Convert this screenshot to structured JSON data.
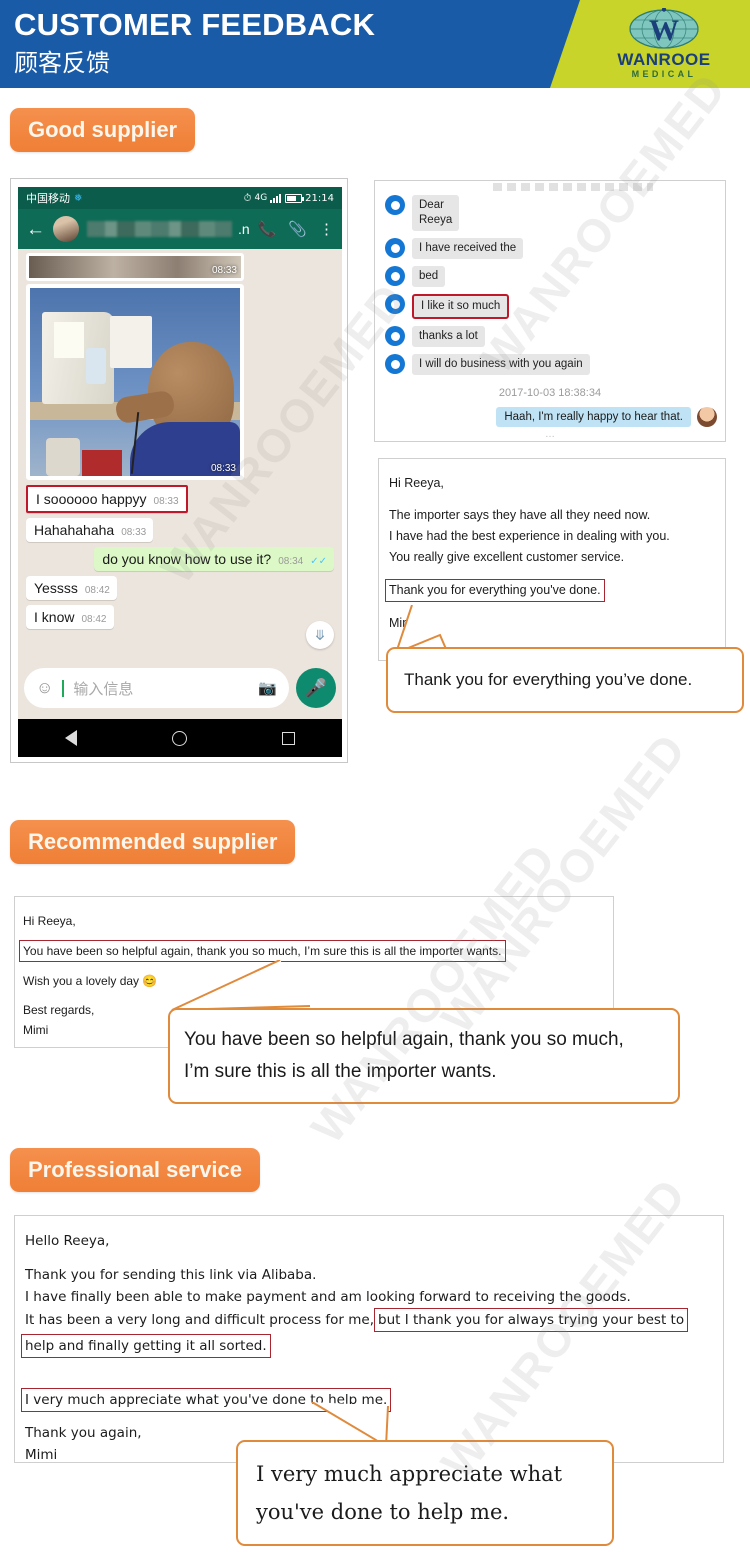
{
  "header": {
    "title_en": "CUSTOMER FEEDBACK",
    "title_cn": "顾客反馈",
    "logo_name": "WANROOE",
    "logo_sub": "MEDICAL",
    "logo_letter": "W",
    "brand_blue": "#1A5BA8",
    "brand_lime": "#C8D429",
    "brand_orange": "#EF7F35"
  },
  "watermark": {
    "text": "WANROOEMED"
  },
  "sections": [
    {
      "badge": "Good supplier"
    },
    {
      "badge": "Recommended supplier"
    },
    {
      "badge": "Professional service"
    }
  ],
  "phone": {
    "carrier": "中国移动",
    "network": "4G",
    "clock": "21:14",
    "contact_suffix": ".n",
    "icons": {
      "back": "back-arrow-icon",
      "call": "phone-icon",
      "attach": "paperclip-icon",
      "more": "more-vertical-icon",
      "alarm": "alarm-icon",
      "emoji": "emoji-icon",
      "camera": "camera-icon",
      "mic": "microphone-icon",
      "scroll": "chevron-double-down-icon"
    },
    "photo_time": "08:33",
    "strip_time": "08:33",
    "messages": [
      {
        "text": "I soooooo happyy",
        "time": "08:33",
        "out": false,
        "highlight": true
      },
      {
        "text": "Hahahahaha",
        "time": "08:33",
        "out": false,
        "highlight": false
      },
      {
        "text": "do you know how to use it?",
        "time": "08:34",
        "out": true,
        "highlight": false
      },
      {
        "text": "Yessss",
        "time": "08:42",
        "out": false,
        "highlight": false
      },
      {
        "text": "I know",
        "time": "08:42",
        "out": false,
        "highlight": false
      }
    ],
    "input_placeholder": "输入信息"
  },
  "webchat": {
    "incoming": [
      {
        "text": "Dear\nReeya",
        "highlight": false
      },
      {
        "text": "I have received the",
        "highlight": false
      },
      {
        "text": "bed",
        "highlight": false
      },
      {
        "text": "I like it so much",
        "highlight": true
      },
      {
        "text": "thanks a lot",
        "highlight": false
      },
      {
        "text": "I will do business with you again",
        "highlight": false
      }
    ],
    "timestamp": "2017-10-03 18:38:34",
    "outgoing": "Haah, I'm really happy to hear that."
  },
  "mail1": {
    "greeting": "Hi Reeya,",
    "lines": [
      "The importer says they have all they need now.",
      "I have had the best experience in dealing with you.",
      "You really give excellent customer service."
    ],
    "highlighted": "Thank you for everything you've done.",
    "signature": "Mimi",
    "callout": "Thank you for everything you’ve done."
  },
  "mail2": {
    "greeting": "Hi Reeya,",
    "highlighted": "You have been so helpful again, thank you so much, I’m sure this is all the importer wants.",
    "wish": "Wish you a lovely day",
    "emoji": "smiley-face-icon",
    "signoff1": "Best regards,",
    "signoff2": "Mimi",
    "callout_line1": "You have been so helpful again, thank you so much,",
    "callout_line2": "I’m sure this is all the importer wants."
  },
  "mail3": {
    "greeting": "Hello Reeya,",
    "line1": "Thank you for sending this link via Alibaba.",
    "line2": "I have finally been able to make payment and am looking forward to receiving the goods.",
    "line3_plain": "It has been a very long and difficult process for me,",
    "line3_hl": "but I thank you for always trying your best to",
    "line4_hl": "help and finally getting it all sorted.",
    "highlighted2": "I very much appreciate what you've done to help me.",
    "signoff1": "Thank you again,",
    "signoff2": "Mimi",
    "callout_line1": "I very much appreciate what",
    "callout_line2": "you've done to help me."
  }
}
